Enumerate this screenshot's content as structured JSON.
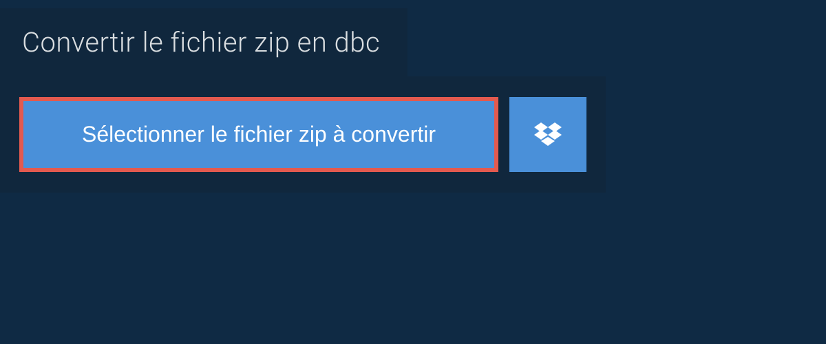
{
  "header": {
    "title": "Convertir le fichier zip en dbc"
  },
  "actions": {
    "select_file_label": "Sélectionner le fichier zip à convertir",
    "dropbox_icon": "dropbox"
  },
  "colors": {
    "background": "#0f2a44",
    "panel": "#10273d",
    "button": "#4a90d9",
    "highlight_border": "#e35a4f",
    "text_light": "#d9dde0",
    "text_white": "#ffffff"
  }
}
